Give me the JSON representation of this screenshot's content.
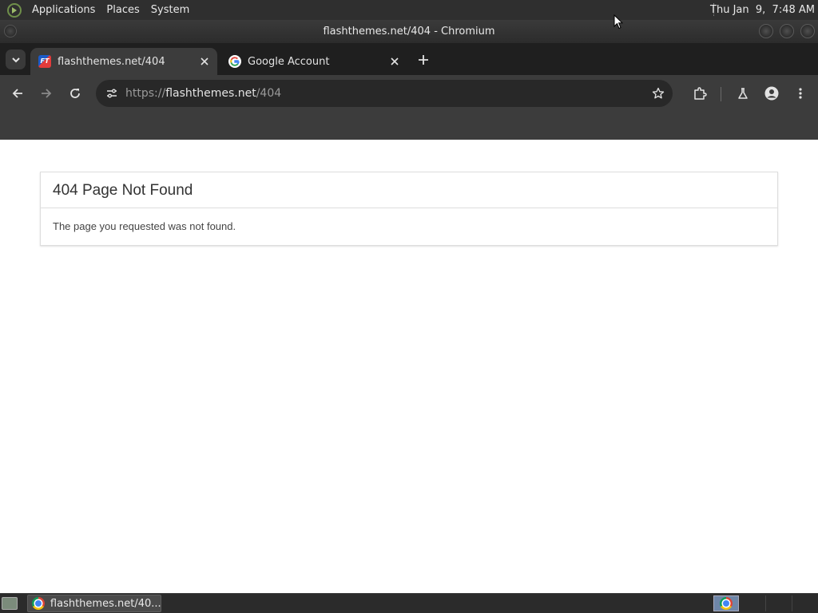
{
  "top_panel": {
    "menus": [
      "Applications",
      "Places",
      "System"
    ],
    "clock": "Thu Jan  9,  7:48 AM"
  },
  "window": {
    "title": "flashthemes.net/404 - Chromium"
  },
  "tabs": [
    {
      "title": "flashthemes.net/404",
      "favicon": "flashthemes-favicon",
      "active": true
    },
    {
      "title": "Google Account",
      "favicon": "google-g-icon",
      "active": false
    }
  ],
  "omnibox": {
    "scheme": "https://",
    "host": "flashthemes.net",
    "path": "/404"
  },
  "page": {
    "heading": "404 Page Not Found",
    "body": "The page you requested was not found."
  },
  "taskbar": {
    "task_label": "flashthemes.net/40..."
  },
  "colors": {
    "chrome_dark": "#1f1f1f",
    "toolbar": "#3c3c3c",
    "omnibox": "#282828",
    "panel_border": "#dddddd"
  }
}
